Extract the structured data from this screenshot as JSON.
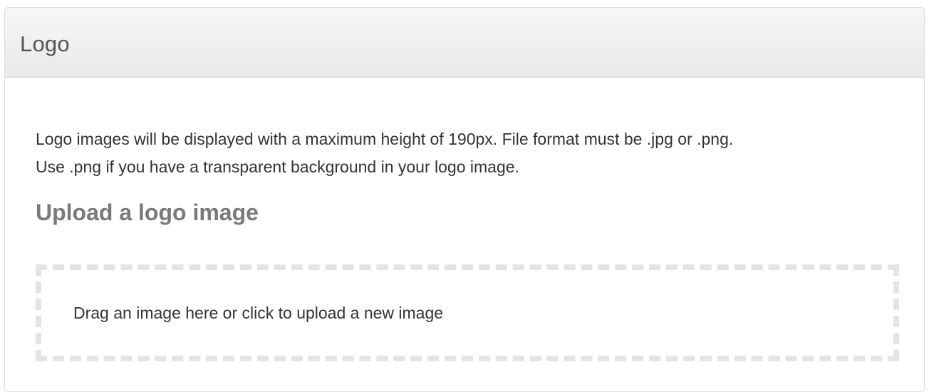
{
  "panel": {
    "title": "Logo",
    "description_line1": "Logo images will be displayed with a maximum height of 190px. File format must be .jpg or .png.",
    "description_line2": "Use .png if you have a transparent background in your logo image.",
    "upload_heading": "Upload a logo image",
    "dropzone_text": "Drag an image here or click to upload a new image"
  },
  "colors": {
    "header_bg": "#ececec",
    "title_text": "#555555",
    "body_text": "#333333",
    "heading_text": "#7a7a7a",
    "dropzone_border": "#e4e4e4"
  }
}
